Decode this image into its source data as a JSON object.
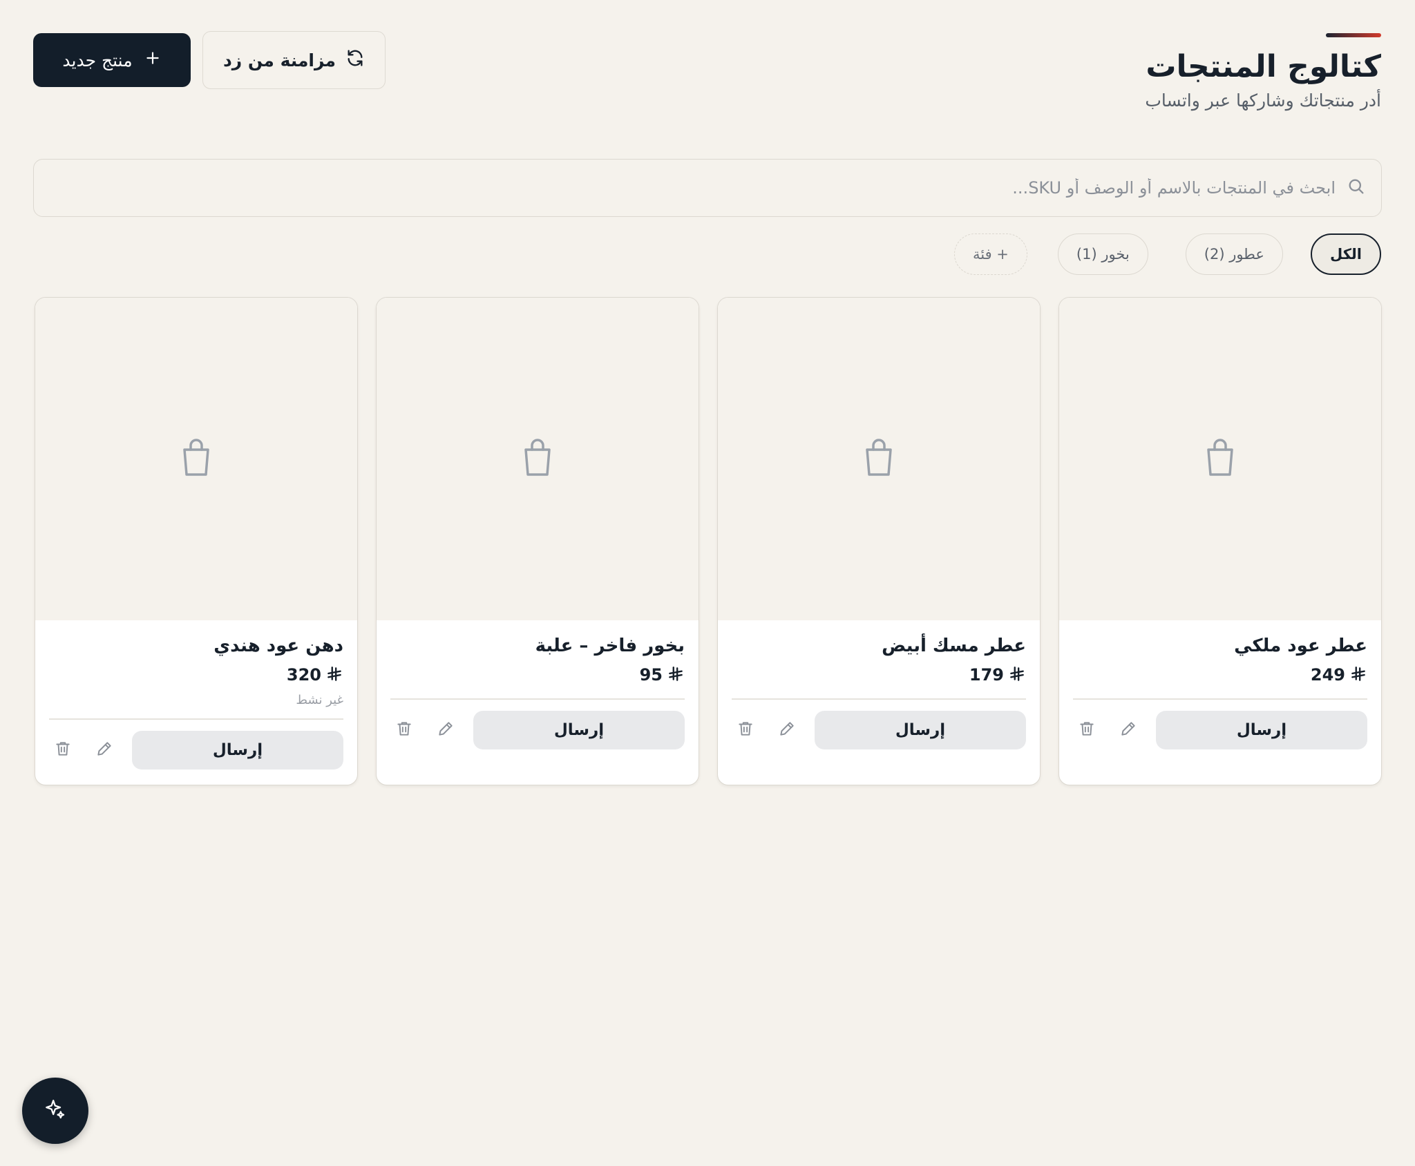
{
  "header": {
    "title": "كتالوج المنتجات",
    "subtitle": "أدر منتجاتك وشاركها عبر واتساب",
    "new_product_label": "منتج جديد",
    "sync_label": "مزامنة من زد"
  },
  "search": {
    "placeholder": "ابحث في المنتجات بالاسم أو الوصف أو SKU...",
    "value": ""
  },
  "filters": {
    "all": "الكل",
    "perfumes": "عطور (2)",
    "incense": "بخور (1)",
    "add_category": "+ فئة"
  },
  "products": [
    {
      "name": "عطر عود ملكي",
      "price": "249",
      "status": ""
    },
    {
      "name": "عطر مسك أبيض",
      "price": "179",
      "status": ""
    },
    {
      "name": "بخور فاخر – علبة",
      "price": "95",
      "status": ""
    },
    {
      "name": "دهن عود هندي",
      "price": "320",
      "status": "غير نشط"
    }
  ],
  "card_actions": {
    "send_label": "إرسال"
  },
  "colors": {
    "background": "#f5f2ec",
    "primary": "#131e2a",
    "accent": "#d23a2c",
    "secondary_button": "#e8e9eb"
  },
  "icons": {
    "placeholder": "shopping-bag-icon",
    "search": "search-icon",
    "sync": "refresh-icon",
    "add": "plus-icon",
    "edit": "pencil-icon",
    "delete": "trash-icon",
    "fab": "sparkles-icon"
  }
}
